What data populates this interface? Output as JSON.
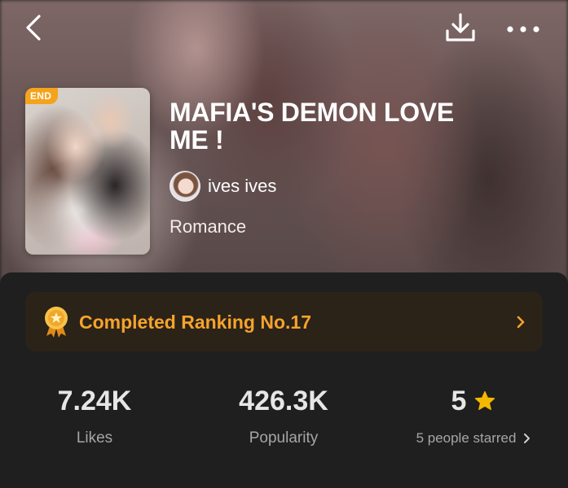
{
  "header": {
    "back_icon": "chevron-left-icon",
    "download_icon": "download-icon",
    "more_icon": "more-horizontal-icon"
  },
  "book": {
    "badge": "END",
    "title": "MAFIA'S DEMON LOVE ME !",
    "author": "ives ives",
    "genre": "Romance"
  },
  "ranking": {
    "label": "Completed Ranking No.17",
    "icon": "medal-icon",
    "color": "#f5a32c"
  },
  "stats": {
    "likes_value": "7.24K",
    "likes_label": "Likes",
    "popularity_value": "426.3K",
    "popularity_label": "Popularity",
    "rating_value": "5",
    "rating_label": "5 people starred",
    "star_color": "#f5b800"
  }
}
